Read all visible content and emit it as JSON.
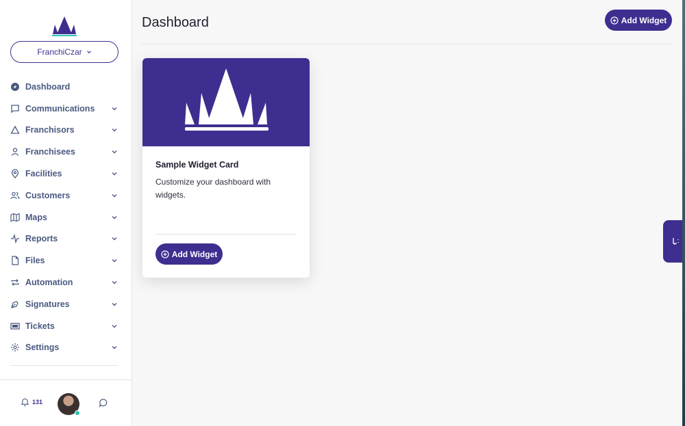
{
  "sidebar": {
    "org_name": "FranchiCzar",
    "items": [
      {
        "label": "Dashboard",
        "icon": "compass-icon",
        "has_chevron": false
      },
      {
        "label": "Communications",
        "icon": "message-icon",
        "has_chevron": true
      },
      {
        "label": "Franchisors",
        "icon": "triangle-icon",
        "has_chevron": true
      },
      {
        "label": "Franchisees",
        "icon": "user-icon",
        "has_chevron": true
      },
      {
        "label": "Facilities",
        "icon": "map-pin-icon",
        "has_chevron": true
      },
      {
        "label": "Customers",
        "icon": "users-icon",
        "has_chevron": true
      },
      {
        "label": "Maps",
        "icon": "map-icon",
        "has_chevron": true
      },
      {
        "label": "Reports",
        "icon": "activity-icon",
        "has_chevron": true
      },
      {
        "label": "Files",
        "icon": "file-icon",
        "has_chevron": true
      },
      {
        "label": "Automation",
        "icon": "repeat-icon",
        "has_chevron": true
      },
      {
        "label": "Signatures",
        "icon": "pen-tool-icon",
        "has_chevron": true
      },
      {
        "label": "Tickets",
        "icon": "ticket-icon",
        "has_chevron": true
      },
      {
        "label": "Settings",
        "icon": "gear-icon",
        "has_chevron": true
      }
    ],
    "notifications_count": "131"
  },
  "header": {
    "title": "Dashboard",
    "add_widget_label": "Add Widget"
  },
  "card": {
    "title": "Sample Widget Card",
    "description": "Customize your dashboard with widgets.",
    "button_label": "Add Widget"
  },
  "colors": {
    "brand": "#3e2e8f",
    "nav_text": "#4a5a80",
    "online": "#2cc5b0"
  }
}
